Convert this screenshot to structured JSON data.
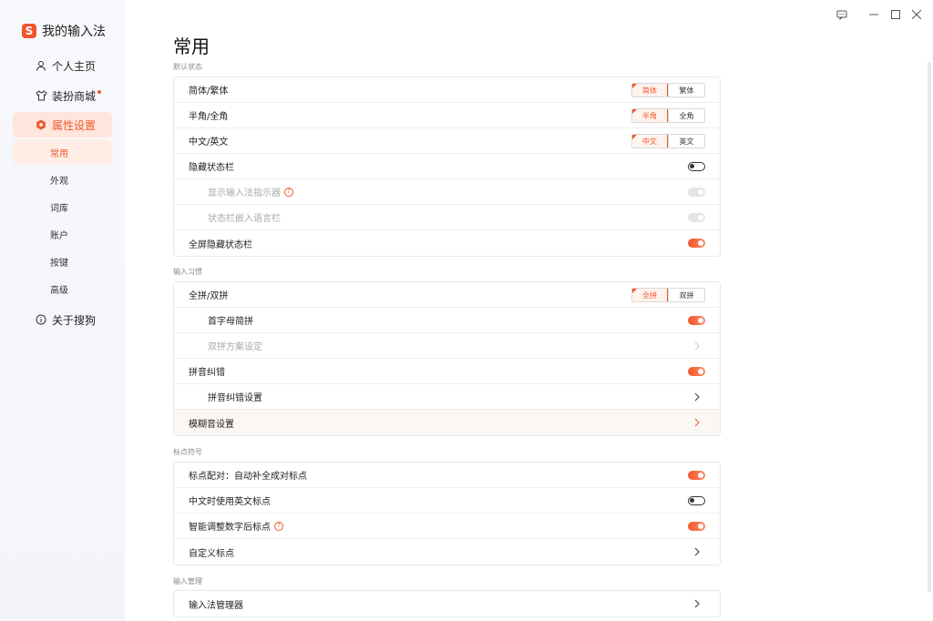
{
  "brand": {
    "logo_char": "S",
    "name": "我的输入法"
  },
  "sidebar": {
    "items": [
      {
        "label": "个人主页",
        "icon": "user-icon"
      },
      {
        "label": "装扮商城",
        "icon": "shirt-icon",
        "badge": true
      },
      {
        "label": "属性设置",
        "icon": "settings-hex-icon",
        "active": true
      }
    ],
    "sub_items": [
      "常用",
      "外观",
      "词库",
      "账户",
      "按键",
      "高级"
    ],
    "about": {
      "label": "关于搜狗",
      "icon": "info-icon"
    }
  },
  "window": {
    "controls": [
      "feedback-icon",
      "minimize-icon",
      "maximize-icon",
      "close-icon"
    ]
  },
  "page": {
    "title": "常用"
  },
  "sections": {
    "default_state": {
      "label": "默认状态",
      "rows": {
        "simp_trad": {
          "label": "简体/繁体",
          "opt_on": "简体",
          "opt_off": "繁体"
        },
        "half_full": {
          "label": "半角/全角",
          "opt_on": "半角",
          "opt_off": "全角"
        },
        "cn_en": {
          "label": "中文/英文",
          "opt_on": "中文",
          "opt_off": "英文"
        },
        "hide_status": {
          "label": "隐藏状态栏"
        },
        "show_indicator": {
          "label": "显示输入法指示器"
        },
        "embed_lang": {
          "label": "状态栏嵌入语言栏"
        },
        "fullscreen_hide": {
          "label": "全屏隐藏状态栏"
        }
      }
    },
    "input_habit": {
      "label": "输入习惯",
      "rows": {
        "pinyin_mode": {
          "label": "全拼/双拼",
          "opt_on": "全拼",
          "opt_off": "双拼"
        },
        "initials": {
          "label": "首字母简拼"
        },
        "shuangpin_scheme": {
          "label": "双拼方案设定"
        },
        "correction": {
          "label": "拼音纠错"
        },
        "correction_settings": {
          "label": "拼音纠错设置"
        },
        "fuzzy": {
          "label": "模糊音设置"
        }
      }
    },
    "punctuation": {
      "label": "标点符号",
      "rows": {
        "pairing": {
          "label": "标点配对：自动补全成对标点"
        },
        "en_punct": {
          "label": "中文时使用英文标点"
        },
        "smart_digit": {
          "label": "智能调整数字后标点"
        },
        "custom": {
          "label": "自定义标点"
        }
      }
    },
    "management": {
      "label": "输入管理",
      "rows": {
        "manager": {
          "label": "输入法管理器"
        }
      }
    }
  },
  "help_glyph": "?",
  "colors": {
    "accent": "#f2552c",
    "active_bg": "#ffe5dc"
  }
}
